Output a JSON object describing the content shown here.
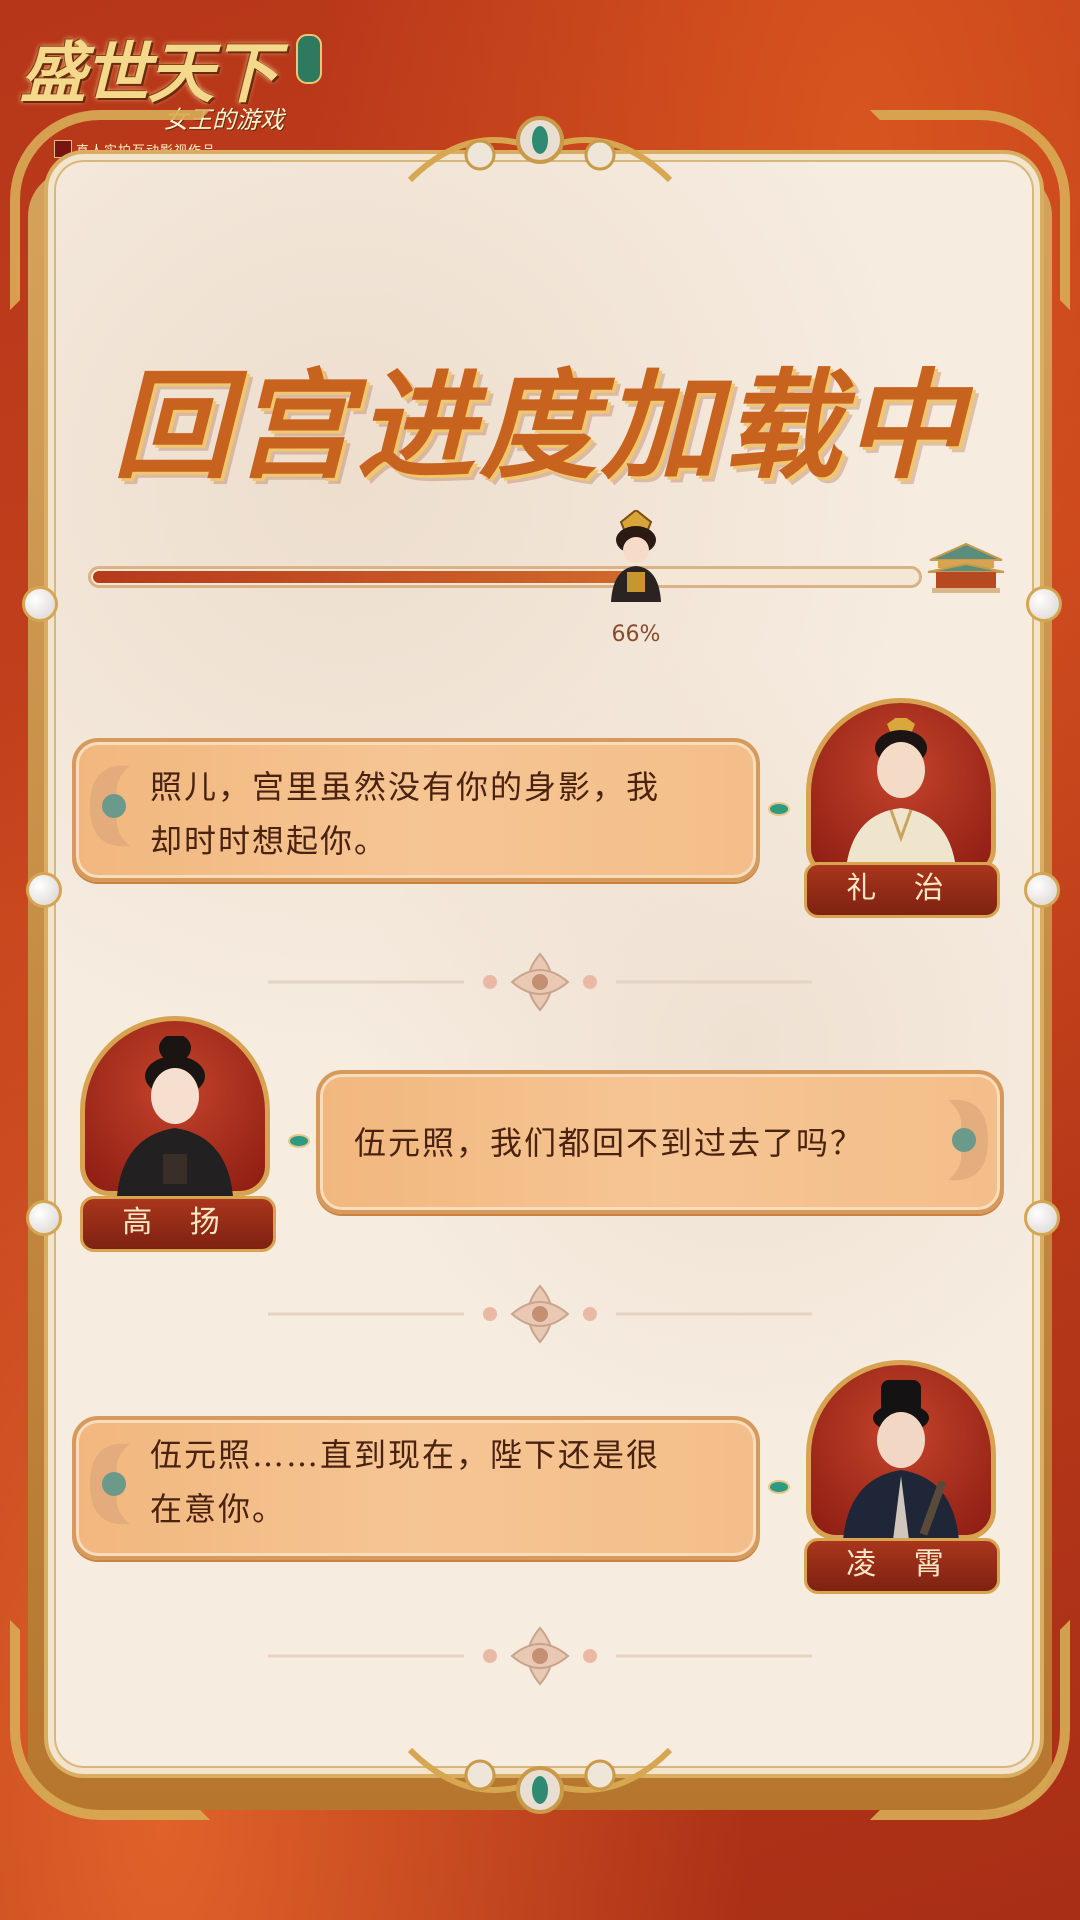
{
  "logo": {
    "main": "盛世天下",
    "sub": "女王的游戏",
    "tag": "真人实拍互动影视作品"
  },
  "title": "回宫进度加载中",
  "progress": {
    "value": 0.66,
    "label": "66%"
  },
  "dialogues": [
    {
      "text_line1": "照儿，宫里虽然没有你的身影，我",
      "text_line2": "却时时想起你。",
      "speaker": "礼 治",
      "side": "right"
    },
    {
      "text_line1": "伍元照，我们都回不到过去了吗？",
      "text_line2": "",
      "speaker": "高 扬",
      "side": "left"
    },
    {
      "text_line1": "伍元照……直到现在，陛下还是很",
      "text_line2": "在意你。",
      "speaker": "凌 霄",
      "side": "right"
    }
  ],
  "colors": {
    "background": "#b83a1a",
    "panel": "#f6ece0",
    "bubble": "#f3be89",
    "nameplate": "#8e2a16",
    "gold": "#d9a451"
  },
  "icons": {
    "progress_marker": "empress-avatar-icon",
    "goal": "palace-icon",
    "divider": "flower-ornament-icon"
  }
}
